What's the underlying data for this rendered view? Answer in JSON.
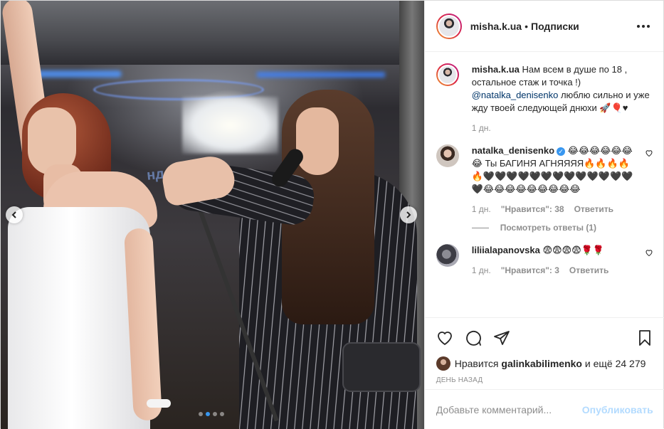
{
  "post": {
    "author": "misha.k.ua",
    "separator": "•",
    "follow_label": "Подписки",
    "more_icon": "more-horizontal-icon"
  },
  "photo": {
    "sign_text": "ндор  Моё",
    "carousel": {
      "count": 4,
      "active_index": 2
    }
  },
  "caption": {
    "username": "misha.k.ua",
    "text_part1": "Нам всем в душе по 18 , остальное стаж и точка !)",
    "mention": "@natalka_denisenko",
    "text_part2": "люблю сильно и уже жду твоей следующей днюхи 🚀🎈♥",
    "time": "1 дн."
  },
  "comments": [
    {
      "username": "natalka_denisenko",
      "verified": true,
      "text": "😂😂😂😂😂😂😂 Ты БАГИНЯ АГНЯЯЯЯ🔥🔥🔥🔥🔥🖤🖤🖤🖤🖤🖤🖤🖤🖤🖤🖤🖤🖤🖤😂😂😂😂😂😂😂😂😂",
      "time": "1 дн.",
      "likes": "\"Нравится\": 38",
      "reply": "Ответить",
      "view_replies": "Посмотреть ответы (1)"
    },
    {
      "username": "liliialapanovska",
      "verified": false,
      "text": "😨😨😨😨🌹🌹",
      "time": "1 дн.",
      "likes": "\"Нравится\": 3",
      "reply": "Ответить"
    }
  ],
  "actions": {
    "liked_by_prefix": "Нравится",
    "liked_by_user": "galinkabilimenko",
    "liked_by_suffix": "и ещё 24 279",
    "date": "ДЕНЬ НАЗАД"
  },
  "add_comment": {
    "placeholder": "Добавьте комментарий...",
    "publish_label": "Опубликовать"
  },
  "colors": {
    "link": "#003569",
    "muted": "#8e8e8e",
    "publish_disabled": "#b3dbff",
    "verified": "#3897f0",
    "carousel_active": "#3897f0"
  }
}
